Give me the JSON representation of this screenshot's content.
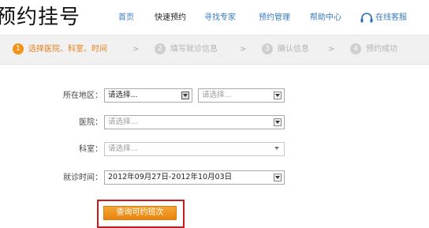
{
  "header": {
    "brand": "预约挂号",
    "nav": [
      {
        "label": "首页",
        "active": false
      },
      {
        "label": "快速预约",
        "active": true
      },
      {
        "label": "寻找专家",
        "active": false
      },
      {
        "label": "预约管理",
        "active": false
      },
      {
        "label": "帮助中心",
        "active": false
      },
      {
        "label": "在线客服",
        "active": false,
        "icon": "headset-icon"
      }
    ]
  },
  "steps": [
    {
      "num": "1",
      "label": "选择医院、科室、时间",
      "active": true
    },
    {
      "num": "2",
      "label": "填写就诊信息",
      "active": false
    },
    {
      "num": "3",
      "label": "确认信息",
      "active": false
    },
    {
      "num": "4",
      "label": "预约成功",
      "active": false
    }
  ],
  "step_separator": ">",
  "form": {
    "region": {
      "label": "所在地区：",
      "province": "请选择...",
      "city": "请选择..."
    },
    "hospital": {
      "label": "医院：",
      "value": "请选择..."
    },
    "department": {
      "label": "科室：",
      "value": "请选择..."
    },
    "visit_time": {
      "label": "就诊时间：",
      "value": "2012年09月27日-2012年10月03日"
    }
  },
  "query_button": "查询可约班次",
  "colors": {
    "accent": "#f39419",
    "nav_link": "#3a7bbf",
    "highlight": "#c8191d"
  }
}
